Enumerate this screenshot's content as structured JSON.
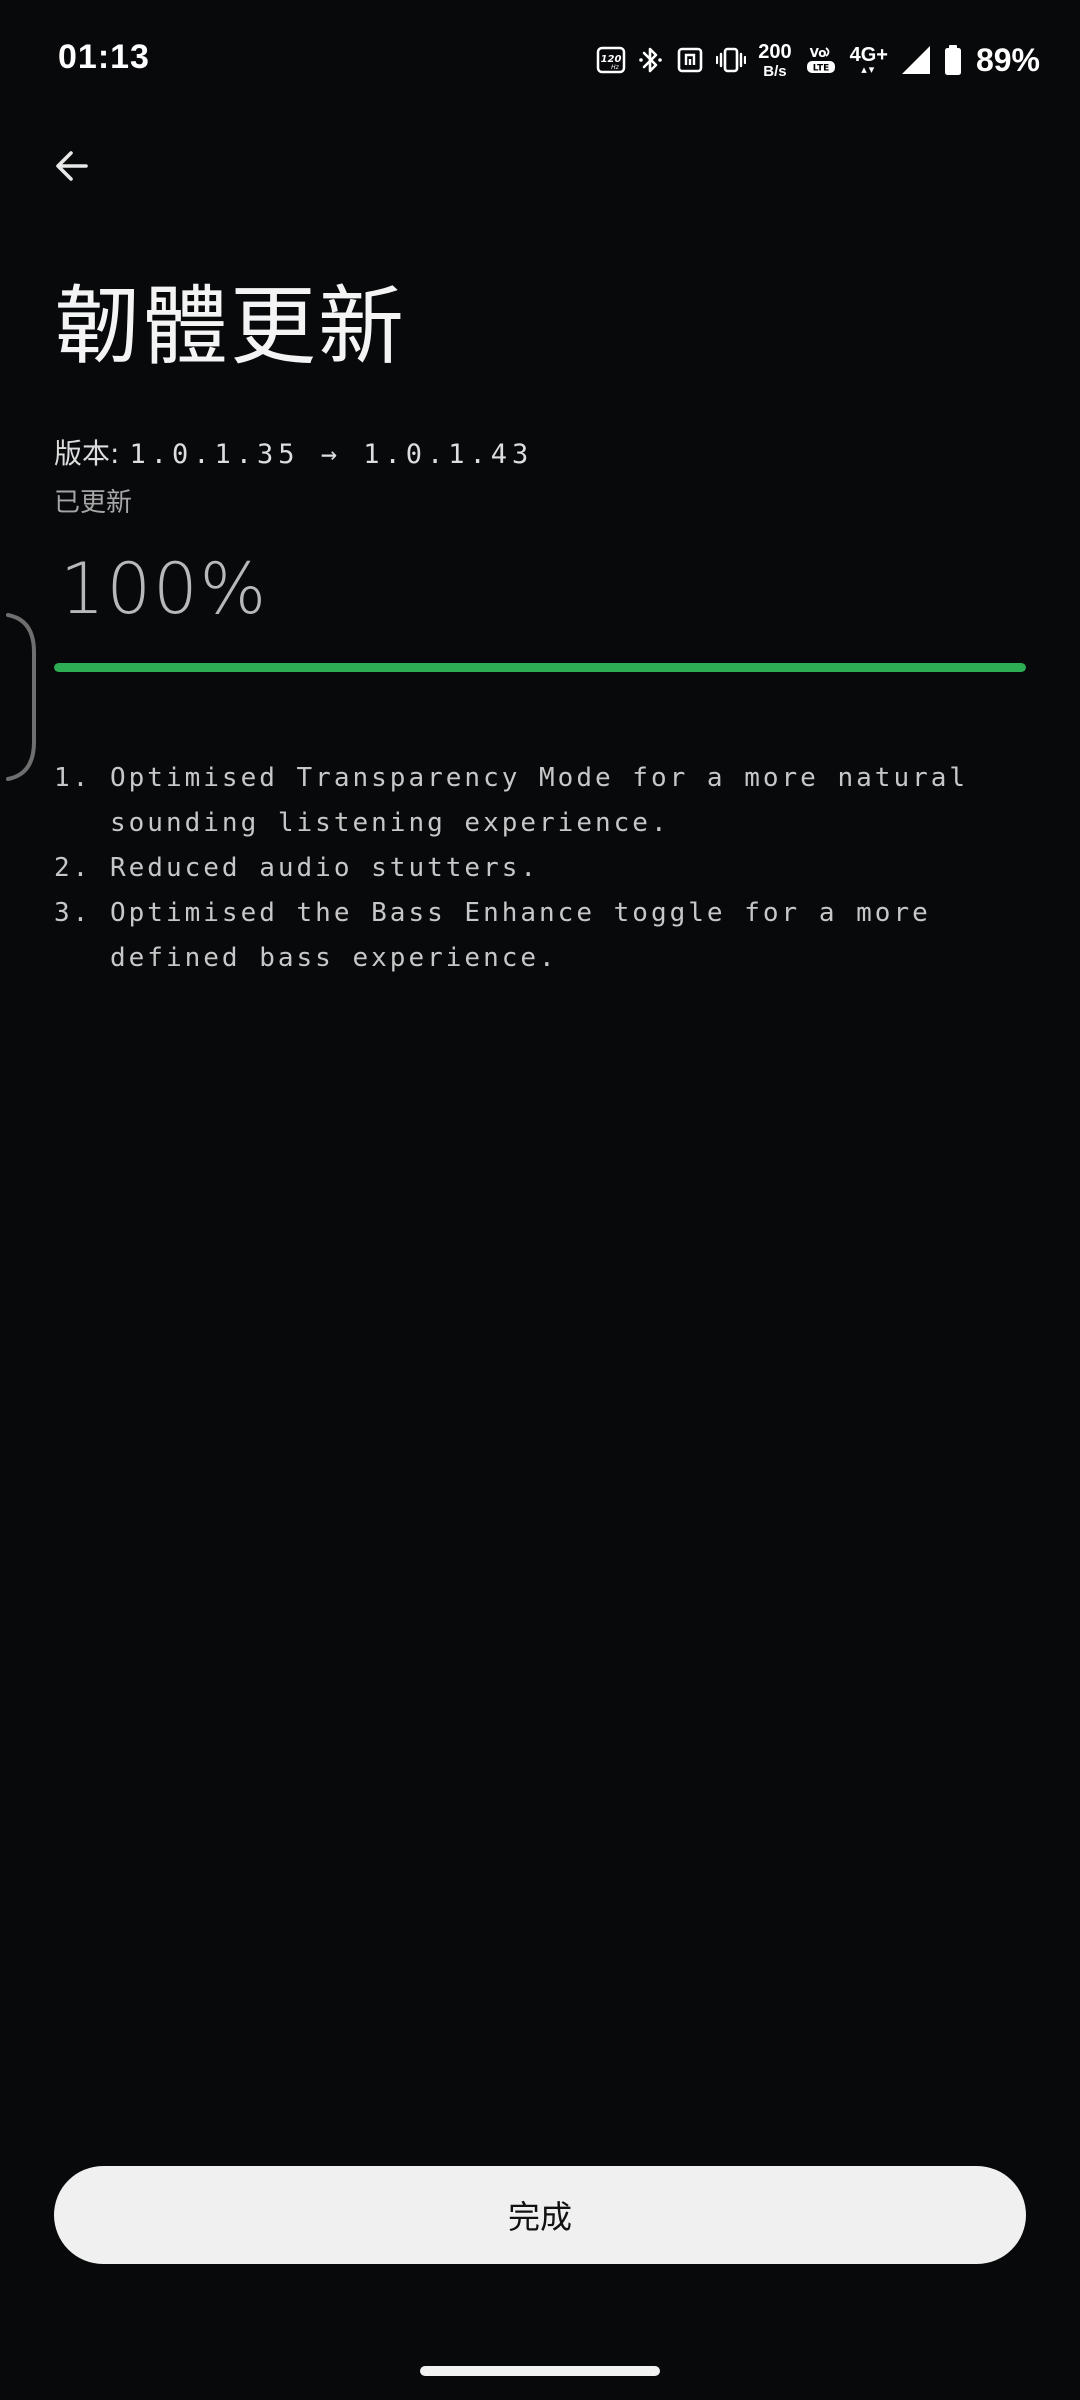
{
  "status_bar": {
    "time": "01:13",
    "refresh_rate": "120",
    "refresh_unit": "Hz",
    "net_speed_value": "200",
    "net_speed_unit": "B/s",
    "volte": "Vo LTE",
    "network": "4G+",
    "battery": "89%",
    "icons": [
      "refresh-rate-icon",
      "bluetooth-icon",
      "nfc-icon",
      "vibrate-icon",
      "volte-icon",
      "signal-icon",
      "battery-icon"
    ]
  },
  "header": {
    "back_icon": "arrow-left-icon",
    "title": "韌體更新"
  },
  "update": {
    "version_label": "版本:",
    "version_value": "1.0.1.35 → 1.0.1.43",
    "status": "已更新",
    "progress_text": "100%",
    "progress_fraction": 1.0,
    "progress_color": "#2dae55"
  },
  "notes": [
    {
      "num": "1.",
      "text": "Optimised Transparency Mode for a more natural sounding listening experience."
    },
    {
      "num": "2.",
      "text": "Reduced audio stutters."
    },
    {
      "num": "3.",
      "text": "Optimised the Bass Enhance toggle for a more defined bass experience."
    }
  ],
  "footer": {
    "done_label": "完成"
  },
  "colors": {
    "background": "#08090b",
    "button_bg": "#eff0ef",
    "accent_green": "#2dae55"
  }
}
